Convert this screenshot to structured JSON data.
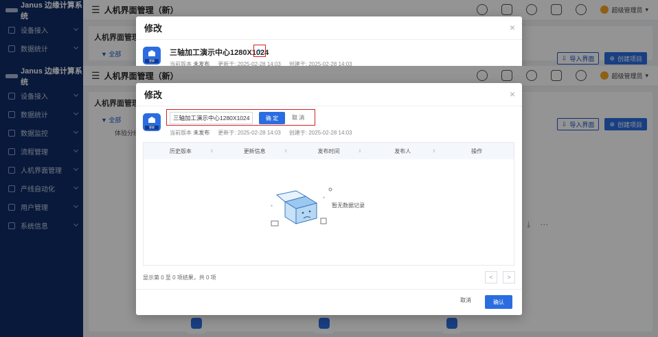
{
  "app": {
    "name": "Janus 边缘计算系统",
    "page_title": "人机界面管理（新）"
  },
  "sidebar": {
    "items": [
      {
        "label": "设备接入"
      },
      {
        "label": "数据统计"
      },
      {
        "label": "数据监控"
      },
      {
        "label": "流程管理"
      },
      {
        "label": "人机界面管理"
      },
      {
        "label": "产线自动化"
      },
      {
        "label": "用户管理"
      },
      {
        "label": "系统信息"
      }
    ]
  },
  "topbar": {
    "user": "超级管理员"
  },
  "content": {
    "card_title": "人机界面管理",
    "tree_all": "▼ 全部",
    "tree_group": "体验分组",
    "import_label": "导入界面",
    "create_label": "创建项目"
  },
  "modal": {
    "title": "修改",
    "close": "×",
    "project_name": "三轴加工演示中心1280X1024",
    "icon_tag": "更换",
    "edit_icon": "✎",
    "meta_version_label": "当前版本",
    "meta_version_value": "未发布",
    "meta_updated_label": "更新于:",
    "meta_updated_value": "2025-02-28 14:03",
    "meta_created_label": "创建于:",
    "meta_created_value": "2025-02-28 14:03",
    "name_input_value": "三轴加工演示中心1280X1024",
    "ok_label": "确 定",
    "cancel_inline_label": "取 消",
    "table_columns": [
      "历史版本",
      "更新信息",
      "发布时间",
      "发布人",
      "操作"
    ],
    "empty_text": "暂无数据记录",
    "footer_info": "显示第 0 至 0 项结果，共 0 项",
    "prev": "<",
    "next": ">",
    "cancel_label": "取消",
    "confirm_label": "确认"
  },
  "colors": {
    "sidebar": "#0f2c66",
    "primary": "#2b6de0",
    "highlight": "#d32020"
  }
}
